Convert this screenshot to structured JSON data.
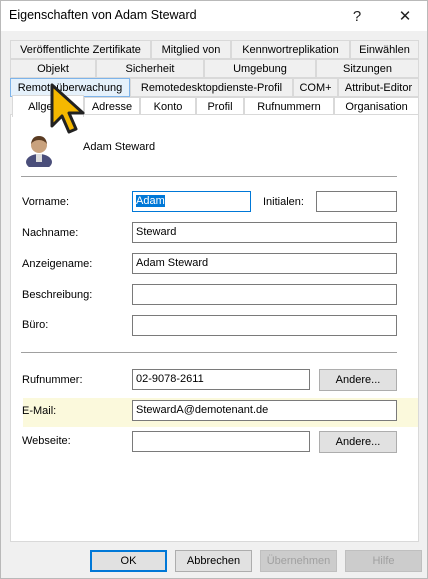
{
  "window": {
    "title": "Eigenschaften von Adam Steward",
    "help_label": "?",
    "close_label": "✕"
  },
  "tabs": {
    "row1": [
      "Veröffentlichte Zertifikate",
      "Mitglied von",
      "Kennwortreplikation",
      "Einwählen"
    ],
    "row2": [
      "Objekt",
      "Sicherheit",
      "Umgebung",
      "Sitzungen"
    ],
    "row3": [
      "Remoteüberwachung",
      "Remotedesktopdienste-Profil",
      "COM+",
      "Attribut-Editor"
    ],
    "row4": [
      "Allgemein",
      "Adresse",
      "Konto",
      "Profil",
      "Rufnummern",
      "Organisation"
    ],
    "active": "Allgemein",
    "active_display": "Allgeme"
  },
  "user": {
    "display_name": "Adam Steward",
    "icon": "user-icon"
  },
  "fields": {
    "vorname": {
      "label": "Vorname:",
      "value": "Adam"
    },
    "initialen": {
      "label": "Initialen:",
      "value": ""
    },
    "nachname": {
      "label": "Nachname:",
      "value": "Steward"
    },
    "anzeigename": {
      "label": "Anzeigename:",
      "value": "Adam Steward"
    },
    "beschreibung": {
      "label": "Beschreibung:",
      "value": ""
    },
    "buero": {
      "label": "Büro:",
      "value": ""
    },
    "rufnummer": {
      "label": "Rufnummer:",
      "value": "02-9078-2611",
      "other_label": "Andere..."
    },
    "email": {
      "label": "E-Mail:",
      "value": "StewardA@demotenant.de"
    },
    "webseite": {
      "label": "Webseite:",
      "value": "",
      "other_label": "Andere..."
    }
  },
  "footer": {
    "ok": "OK",
    "cancel": "Abbrechen",
    "apply": "Übernehmen",
    "help": "Hilfe"
  },
  "colors": {
    "accent": "#0078d7",
    "highlight": "#fbf9dc",
    "cursor": "#f5b800"
  }
}
